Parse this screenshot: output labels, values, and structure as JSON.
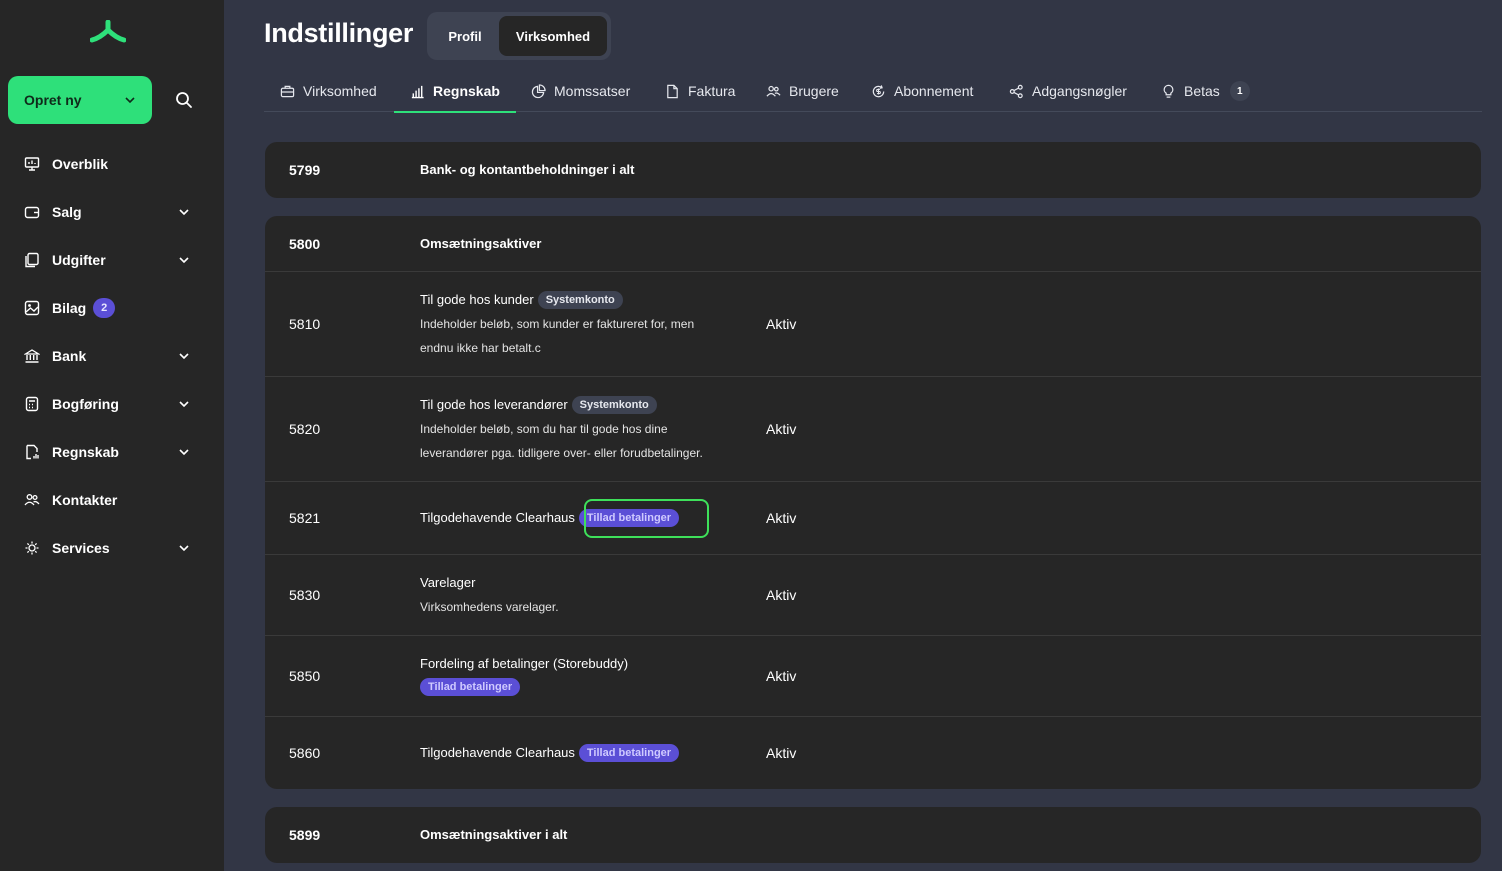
{
  "sidebar": {
    "create_label": "Opret ny",
    "items": [
      {
        "label": "Overblik",
        "icon": "presentation-icon",
        "expandable": false
      },
      {
        "label": "Salg",
        "icon": "wallet-icon",
        "expandable": true
      },
      {
        "label": "Udgifter",
        "icon": "receipt-icon",
        "expandable": true
      },
      {
        "label": "Bilag",
        "icon": "image-icon",
        "expandable": false,
        "badge": "2"
      },
      {
        "label": "Bank",
        "icon": "bank-icon",
        "expandable": true
      },
      {
        "label": "Bogføring",
        "icon": "calculator-icon",
        "expandable": true
      },
      {
        "label": "Regnskab",
        "icon": "report-icon",
        "expandable": true
      },
      {
        "label": "Kontakter",
        "icon": "contacts-icon",
        "expandable": false
      },
      {
        "label": "Services",
        "icon": "services-icon",
        "expandable": true
      }
    ]
  },
  "header": {
    "title": "Indstillinger",
    "segments": [
      "Profil",
      "Virksomhed"
    ],
    "active_segment": "Virksomhed"
  },
  "tabs": [
    {
      "label": "Virksomhed",
      "icon": "briefcase-icon"
    },
    {
      "label": "Regnskab",
      "icon": "bar-chart-icon",
      "active": true
    },
    {
      "label": "Momssatser",
      "icon": "pie-chart-icon"
    },
    {
      "label": "Faktura",
      "icon": "document-icon"
    },
    {
      "label": "Brugere",
      "icon": "users-icon"
    },
    {
      "label": "Abonnement",
      "icon": "refresh-dollar-icon"
    },
    {
      "label": "Adgangsnøgler",
      "icon": "share-icon"
    },
    {
      "label": "Betas",
      "icon": "bulb-icon",
      "count": "1"
    }
  ],
  "groups": [
    {
      "number": "5799",
      "name": "Bank- og kontantbeholdninger i alt"
    },
    {
      "number": "5800",
      "name": "Omsætningsaktiver"
    },
    {
      "number": "5899",
      "name": "Omsætningsaktiver i alt"
    }
  ],
  "accounts": [
    {
      "number": "5810",
      "title": "Til gode hos kunder",
      "tag": "Systemkonto",
      "desc_line1": "Indeholder beløb, som kunder er faktureret for, men",
      "desc_line2": "endnu ikke har betalt.c",
      "status": "Aktiv"
    },
    {
      "number": "5820",
      "title": "Til gode hos leverandører",
      "tag": "Systemkonto",
      "desc_line1": "Indeholder beløb, som du har til gode hos dine",
      "desc_line2": "leverandører pga. tidligere over- eller forudbetalinger.",
      "status": "Aktiv"
    },
    {
      "number": "5821",
      "title": "Tilgodehavende Clearhaus",
      "tag": "Tillad betalinger",
      "status": "Aktiv"
    },
    {
      "number": "5830",
      "title": "Varelager",
      "desc_line1": "Virksomhedens varelager.",
      "status": "Aktiv"
    },
    {
      "number": "5850",
      "title": "Fordeling af betalinger (Storebuddy)",
      "tag": "Tillad betalinger",
      "status": "Aktiv"
    },
    {
      "number": "5860",
      "title": "Tilgodehavende Clearhaus",
      "tag": "Tillad betalinger",
      "status": "Aktiv"
    }
  ],
  "colors": {
    "accent": "#2ee07a",
    "badge": "#5b4fd6",
    "sidebar_bg": "#262626",
    "page_bg": "#323645",
    "highlight": "#3ee05a"
  }
}
